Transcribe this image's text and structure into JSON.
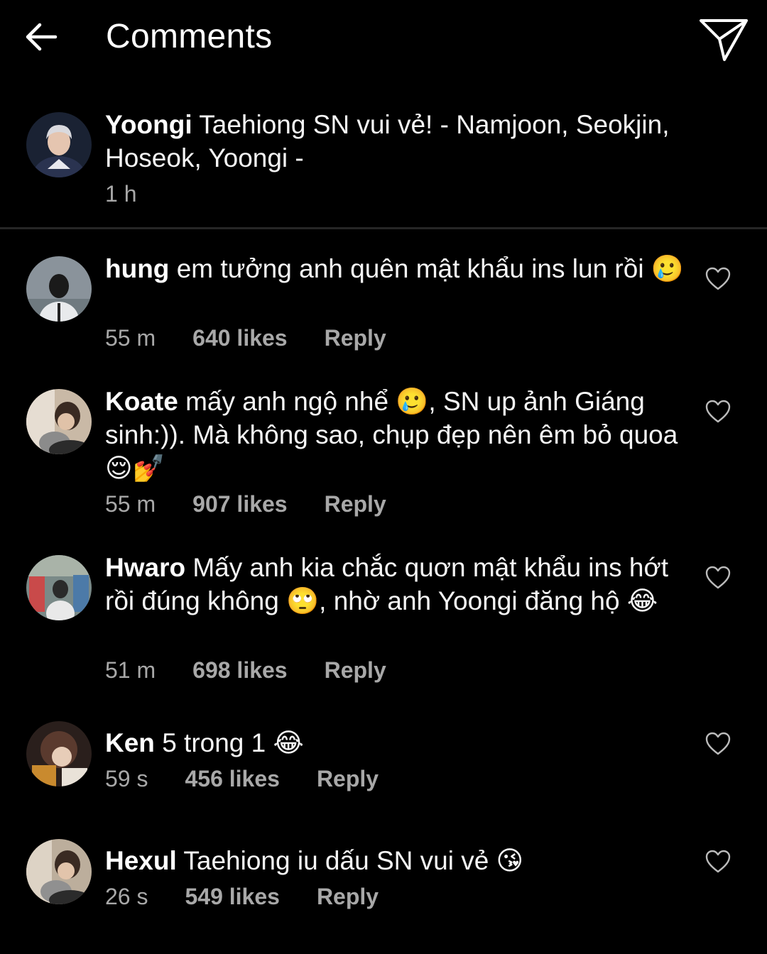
{
  "header": {
    "title": "Comments",
    "back_icon": "arrow-left-icon",
    "send_icon": "paper-plane-icon"
  },
  "caption": {
    "username": "Yoongi",
    "text": "Taehiong SN vui vẻ! - Namjoon, Seokjin, Hoseok, Yoongi -",
    "time": "1 h"
  },
  "comments": [
    {
      "username": "hung",
      "text": "em tưởng anh quên mật khẩu ins lun rồi 🥲",
      "time": "55 m",
      "likes": "640 likes",
      "reply": "Reply"
    },
    {
      "username": "Koate",
      "text": "mấy anh ngộ nhể 🥲, SN up ảnh Giáng sinh:)). Mà không sao, chụp đẹp nên êm bỏ quoa 😌💅",
      "time": "55 m",
      "likes": "907 likes",
      "reply": "Reply"
    },
    {
      "username": "Hwaro",
      "text": "Mấy anh kia chắc quơn mật khẩu ins hớt rồi đúng không 🙄, nhờ anh Yoongi đăng hộ 😂",
      "time": "51 m",
      "likes": "698 likes",
      "reply": "Reply"
    },
    {
      "username": "Ken",
      "text": "5 trong 1 😂",
      "time": "59 s",
      "likes": "456 likes",
      "reply": "Reply"
    },
    {
      "username": "Hexul",
      "text": "Taehiong iu dấu SN vui vẻ 😘",
      "time": "26 s",
      "likes": "549 likes",
      "reply": "Reply"
    }
  ],
  "colors": {
    "background": "#000000",
    "text": "#ffffff",
    "meta": "#a8a8a8",
    "divider": "#262626"
  }
}
